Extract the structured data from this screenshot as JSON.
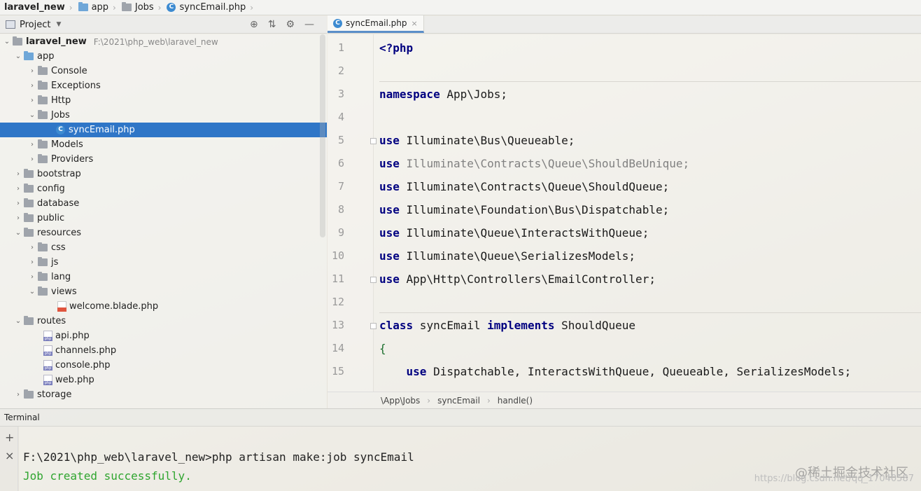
{
  "breadcrumb": {
    "project": "laravel_new",
    "folder1": "app",
    "folder2": "Jobs",
    "file": "syncEmail.php"
  },
  "project_panel": {
    "title": "Project",
    "root_name": "laravel_new",
    "root_path": "F:\\2021\\php_web\\laravel_new",
    "items": {
      "app": "app",
      "console": "Console",
      "exceptions": "Exceptions",
      "http": "Http",
      "jobs": "Jobs",
      "syncemail": "syncEmail.php",
      "models": "Models",
      "providers": "Providers",
      "bootstrap": "bootstrap",
      "config": "config",
      "database": "database",
      "public": "public",
      "resources": "resources",
      "css": "css",
      "js": "js",
      "lang": "lang",
      "views": "views",
      "welcome": "welcome.blade.php",
      "routes": "routes",
      "api": "api.php",
      "channels": "channels.php",
      "console_php": "console.php",
      "web": "web.php",
      "storage": "storage"
    }
  },
  "editor": {
    "tab": "syncEmail.php",
    "line_numbers": [
      "1",
      "2",
      "3",
      "4",
      "5",
      "6",
      "7",
      "8",
      "9",
      "10",
      "11",
      "12",
      "13",
      "14",
      "15"
    ],
    "code": {
      "l1_tag": "<?php",
      "l3_kw": "namespace",
      "l3_rest": " App\\Jobs;",
      "use_kw": "use",
      "l5_rest": " Illuminate\\Bus\\Queueable;",
      "l6_rest": " Illuminate\\Contracts\\Queue\\ShouldBeUnique;",
      "l7_rest": " Illuminate\\Contracts\\Queue\\ShouldQueue;",
      "l8_rest": " Illuminate\\Foundation\\Bus\\Dispatchable;",
      "l9_rest": " Illuminate\\Queue\\InteractsWithQueue;",
      "l10_rest": " Illuminate\\Queue\\SerializesModels;",
      "l11_rest": " App\\Http\\Controllers\\EmailController;",
      "l13_class": "class",
      "l13_name": " syncEmail ",
      "l13_impl": "implements",
      "l13_iface": " ShouldQueue",
      "l14_brace": "{",
      "l15_rest": " Dispatchable, InteractsWithQueue, Queueable, SerializesModels;"
    }
  },
  "navbar": {
    "namespace": "\\App\\Jobs",
    "class": "syncEmail",
    "method": "handle()"
  },
  "terminal": {
    "title": "Terminal",
    "command": "F:\\2021\\php_web\\laravel_new>php artisan make:job syncEmail",
    "output": "Job created successfully."
  },
  "watermark": {
    "text": "@稀土掘金技术社区",
    "url": "https://blog.csdn.net/qq_17040587"
  }
}
